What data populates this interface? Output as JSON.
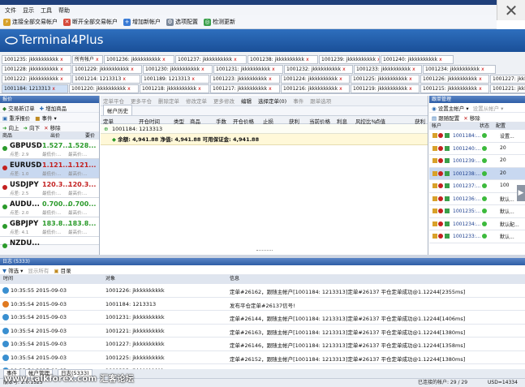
{
  "menu": [
    "文件",
    "显示",
    "工具",
    "帮助"
  ],
  "toolbar": [
    "连接全部交易帐户",
    "断开全部交易帐户",
    "增加新帐户",
    "选项配置",
    "检测更新"
  ],
  "brand": "Terminal4Plus",
  "account_tabs": [
    [
      "1001235: jkkkkkkkkkk",
      "所有帐户",
      "1001236: jkkkkkkkkkk",
      "1001237: jkkkkkkkkkk",
      "1001238: jkkkkkkkkkk",
      "1001239: jkkkkkkkkkk",
      "1001240: jkkkkkkkkkk"
    ],
    [
      "1001228: jkkkkkkkkkk",
      "1001229: jkkkkkkkkkk",
      "1001230: jkkkkkkkkkk",
      "1001231: jkkkkkkkkkk",
      "1001232: jkkkkkkkkkk",
      "1001233: jkkkkkkkkkk",
      "1001234: jkkkkkkkkkk"
    ],
    [
      "1001222: jkkkkkkkkkk",
      "1001214: 1213313",
      "1001189: 1213313",
      "1001223: jkkkkkkkkkk",
      "1001224: jkkkkkkkkkk",
      "1001225: jkkkkkkkkkk",
      "1001226: jkkkkkkkkkk",
      "1001227: jkkkkkkkkkk"
    ],
    [
      "1001184: 1213313",
      "1001220: jkkkkkkkkkk",
      "1001218: jkkkkkkkkkk",
      "1001217: jkkkkkkkkkk",
      "1001216: jkkkkkkkkkk",
      "1001219: jkkkkkkkkkk",
      "1001215: jkkkkkkkkkk",
      "1001221: jkkkkkkkkkk"
    ]
  ],
  "left_panel": {
    "title": "报价",
    "toolbar1": [
      "交易新订单",
      "增加商品"
    ],
    "toolbar2": [
      "重浮报价",
      "事件"
    ],
    "toolbar3": [
      "向上",
      "向下",
      "移除"
    ],
    "col_headers": [
      "商品",
      "出价",
      "要价"
    ],
    "quotes": [
      {
        "symbol": "GBPUSD",
        "bid": "1.527...",
        "ask": "1.528...",
        "spread": "点差: 2.9",
        "low": "最低价:...",
        "high": "最高价:...",
        "dir": "up"
      },
      {
        "symbol": "EURUSD",
        "bid": "1.121...",
        "ask": "1.121...",
        "spread": "点差: 1.0",
        "low": "最低价:...",
        "high": "最高价:...",
        "dir": "dn"
      },
      {
        "symbol": "USDJPY",
        "bid": "120.3...",
        "ask": "120.3...",
        "spread": "点差: 2.5",
        "low": "最低价:...",
        "high": "最高价:...",
        "dir": "dn"
      },
      {
        "symbol": "AUDU...",
        "bid": "0.700...",
        "ask": "0.700...",
        "spread": "点差: 2.0",
        "low": "最低价:...",
        "high": "最高价:...",
        "dir": "up"
      },
      {
        "symbol": "GBPJPY",
        "bid": "183.8...",
        "ask": "183.8...",
        "spread": "点差: 4.1",
        "low": "最低价:...",
        "high": "最高价:...",
        "dir": "up"
      },
      {
        "symbol": "NZDU...",
        "bid": "",
        "ask": "",
        "spread": "",
        "low": "",
        "high": "",
        "dir": "up"
      }
    ]
  },
  "center": {
    "toolbar": [
      "定单平仓",
      "更多平仓",
      "删除定单",
      "修改定单",
      "更多修改",
      "编辑",
      "选择定单(0)",
      "事件",
      "跟单选项"
    ],
    "tab": "帐户历史",
    "columns": [
      "定单",
      "开仓时间",
      "类型",
      "商品",
      "手数",
      "开仓价格",
      "止损",
      "获利",
      "当前价格",
      "利息",
      "风控比%",
      "点值",
      "获利"
    ],
    "account_row": "1001184: 1213313",
    "balance_row": "余额: 4,941.88  净值: 4,941.88  可用保证金: 4,941.88"
  },
  "right_panel": {
    "title": "跟单管理",
    "toolbar1": [
      "设置主帐户",
      "设置从帐户"
    ],
    "toolbar2": [
      "跟随配置",
      "移除"
    ],
    "col_headers": [
      "帐户",
      "状态",
      "配置"
    ],
    "rows": [
      {
        "id": "1001184:...",
        "config": "设置..."
      },
      {
        "id": "1001240:...",
        "config": "20"
      },
      {
        "id": "1001239:...",
        "config": "20"
      },
      {
        "id": "1001238:...",
        "config": "20"
      },
      {
        "id": "1001237:...",
        "config": "100"
      },
      {
        "id": "1001236:...",
        "config": "默认..."
      },
      {
        "id": "1001235:...",
        "config": "默认..."
      },
      {
        "id": "1001234:...",
        "config": "默认配..."
      },
      {
        "id": "1001233:...",
        "config": "默认..."
      }
    ]
  },
  "log": {
    "title": "日志 (5333)",
    "toolbar": [
      "筛选",
      "显示所有",
      "目录"
    ],
    "columns": [
      "时间",
      "对象",
      "信息"
    ],
    "rows": [
      {
        "time": "10:35:55 2015-09-03",
        "object": "1001226: jkkkkkkkkkk",
        "info": "定单#26162，跟随主帐户[1001184: 1213313]定单#26137 平仓定单成功@1.12244[2355ms]",
        "level": "ok"
      },
      {
        "time": "10:35:54 2015-09-03",
        "object": "1001184: 1213313",
        "info": "发布平仓定单#26137信号!",
        "level": "warn"
      },
      {
        "time": "10:35:54 2015-09-03",
        "object": "1001231: jkkkkkkkkkk",
        "info": "定单#26144，跟随主帐户[1001184: 1213313]定单#26137 平仓定单成功@1.12244[1406ms]",
        "level": "ok"
      },
      {
        "time": "10:35:54 2015-09-03",
        "object": "1001221: jkkkkkkkkkk",
        "info": "定单#26163，跟随主帐户[1001184: 1213313]定单#26137 平仓定单成功@1.12244[1380ms]",
        "level": "ok"
      },
      {
        "time": "10:35:54 2015-09-03",
        "object": "1001227: jkkkkkkkkkk",
        "info": "定单#26146，跟随主帐户[1001184: 1213313]定单#26137 平仓定单成功@1.12244[1358ms]",
        "level": "ok"
      },
      {
        "time": "10:35:54 2015-09-03",
        "object": "1001225: jkkkkkkkkkk",
        "info": "定单#26152，跟随主帐户[1001184: 1213313]定单#26137 平仓定单成功@1.12244[1380ms]",
        "level": "ok"
      },
      {
        "time": "10:35:54 2015-09-03",
        "object": "1001223: jkkkkkkkkkk",
        "info": "定单#26160，跟随主帐户[1001184: 1213313]定单#26137 平仓定单成功@1.12244[1348ms]",
        "level": "ok"
      }
    ]
  },
  "bottom_tabs": [
    "事件",
    "帐户管理",
    "日志(5333)"
  ],
  "status": {
    "version": "版本号: 2.0.1525",
    "connected": "已连接的帐户: 29 / 29",
    "equity": "USD=14334"
  },
  "watermark": "www.talkforex.com 汇客论坛"
}
